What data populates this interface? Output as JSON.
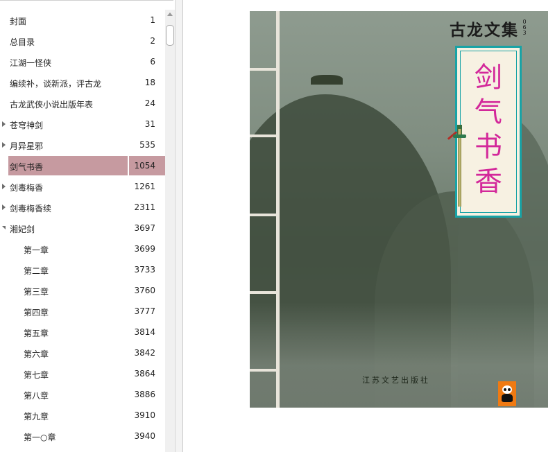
{
  "toc": {
    "items": [
      {
        "title": "封面",
        "page": "1",
        "level": 0,
        "expander": "none"
      },
      {
        "title": "总目录",
        "page": "2",
        "level": 0,
        "expander": "none"
      },
      {
        "title": "江湖一怪侠",
        "page": "6",
        "level": 0,
        "expander": "none"
      },
      {
        "title": "编续补，谈新派，评古龙",
        "page": "18",
        "level": 0,
        "expander": "none"
      },
      {
        "title": "古龙武侠小说出版年表",
        "page": "24",
        "level": 0,
        "expander": "none"
      },
      {
        "title": "苍穹神剑",
        "page": "31",
        "level": 0,
        "expander": "collapsed"
      },
      {
        "title": "月异星邪",
        "page": "535",
        "level": 0,
        "expander": "collapsed"
      },
      {
        "title": "剑气书香",
        "page": "1054",
        "level": 0,
        "expander": "none",
        "selected": true
      },
      {
        "title": "剑毒梅香",
        "page": "1261",
        "level": 0,
        "expander": "collapsed"
      },
      {
        "title": "剑毒梅香续",
        "page": "2311",
        "level": 0,
        "expander": "collapsed"
      },
      {
        "title": "湘妃剑",
        "page": "3697",
        "level": 0,
        "expander": "expanded"
      },
      {
        "title": "第一章",
        "page": "3699",
        "level": 1,
        "expander": "none"
      },
      {
        "title": "第二章",
        "page": "3733",
        "level": 1,
        "expander": "none"
      },
      {
        "title": "第三章",
        "page": "3760",
        "level": 1,
        "expander": "none"
      },
      {
        "title": "第四章",
        "page": "3777",
        "level": 1,
        "expander": "none"
      },
      {
        "title": "第五章",
        "page": "3814",
        "level": 1,
        "expander": "none"
      },
      {
        "title": "第六章",
        "page": "3842",
        "level": 1,
        "expander": "none"
      },
      {
        "title": "第七章",
        "page": "3864",
        "level": 1,
        "expander": "none"
      },
      {
        "title": "第八章",
        "page": "3886",
        "level": 1,
        "expander": "none"
      },
      {
        "title": "第九章",
        "page": "3910",
        "level": 1,
        "expander": "none"
      },
      {
        "title": "第一○章",
        "page": "3940",
        "level": 1,
        "expander": "none"
      }
    ],
    "selected_color": "#c69aa0"
  },
  "cover": {
    "series_title": "古龙文集",
    "series_number": "063",
    "book_title": "剑气书香",
    "publisher": "江苏文艺出版社",
    "title_color": "#d3289a",
    "frame_color": "#18a3a6",
    "logo_icon": "panda-icon"
  }
}
